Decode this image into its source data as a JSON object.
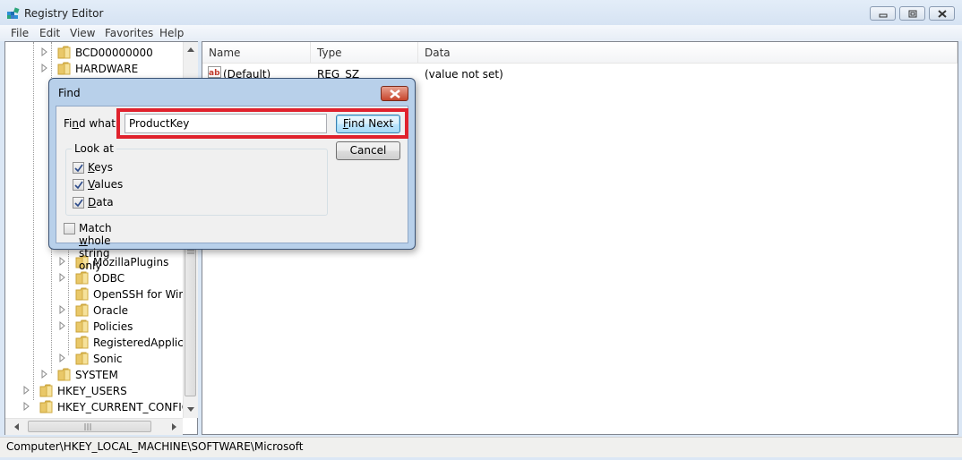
{
  "window": {
    "title": "Registry Editor",
    "controls": [
      "minimize",
      "maximize",
      "close"
    ]
  },
  "menu": [
    "File",
    "Edit",
    "View",
    "Favorites",
    "Help"
  ],
  "tree": {
    "items": [
      {
        "label": "BCD00000000",
        "level": 2,
        "expandable": true
      },
      {
        "label": "HARDWARE",
        "level": 2,
        "expandable": true
      },
      {
        "label": "MozillaPlugins",
        "level": 3,
        "expandable": true
      },
      {
        "label": "ODBC",
        "level": 3,
        "expandable": true
      },
      {
        "label": "OpenSSH for Wind",
        "level": 3,
        "expandable": false
      },
      {
        "label": "Oracle",
        "level": 3,
        "expandable": true
      },
      {
        "label": "Policies",
        "level": 3,
        "expandable": true
      },
      {
        "label": "RegisteredApplica",
        "level": 3,
        "expandable": false
      },
      {
        "label": "Sonic",
        "level": 3,
        "expandable": true
      },
      {
        "label": "SYSTEM",
        "level": 2,
        "expandable": true
      },
      {
        "label": "HKEY_USERS",
        "level": 1,
        "expandable": true
      },
      {
        "label": "HKEY_CURRENT_CONFIG",
        "level": 1,
        "expandable": true
      }
    ]
  },
  "list": {
    "columns": [
      "Name",
      "Type",
      "Data"
    ],
    "rows": [
      {
        "name": "(Default)",
        "type": "REG_SZ",
        "data": "(value not set)",
        "icon": "string-value-icon"
      }
    ]
  },
  "status": {
    "path": "Computer\\HKEY_LOCAL_MACHINE\\SOFTWARE\\Microsoft"
  },
  "find_dialog": {
    "title": "Find",
    "find_what_label_pre": "Fi",
    "find_what_label_acc": "n",
    "find_what_label_post": "d what:",
    "find_what_value": "ProductKey",
    "find_next_acc": "F",
    "find_next_rest": "ind Next",
    "cancel_label": "Cancel",
    "look_at_label": "Look at",
    "options": [
      {
        "acc": "K",
        "rest": "eys",
        "checked": true
      },
      {
        "acc": "V",
        "rest": "alues",
        "checked": true
      },
      {
        "acc": "D",
        "rest": "ata",
        "checked": true
      }
    ],
    "match_whole_pre": "Match ",
    "match_whole_acc": "w",
    "match_whole_post": "hole string only",
    "match_whole_checked": false,
    "highlight_color": "#e0222d"
  }
}
